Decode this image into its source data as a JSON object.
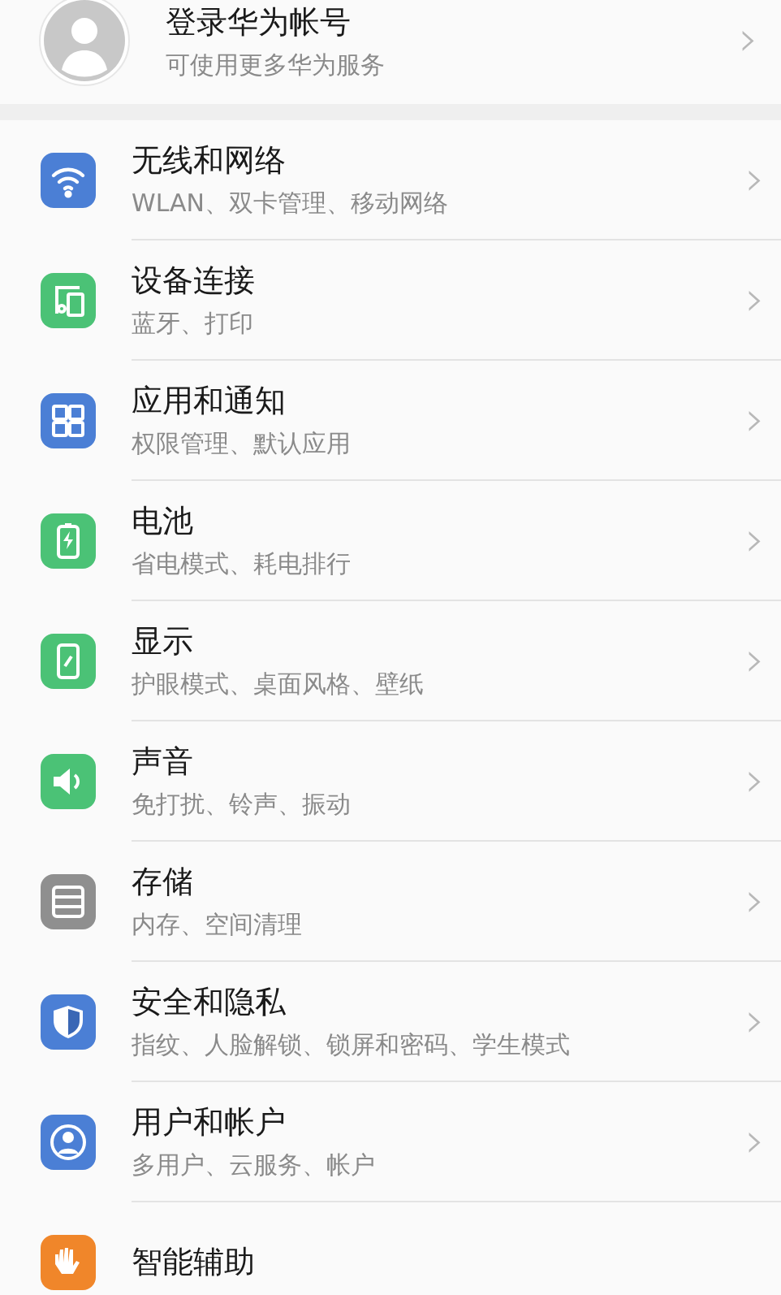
{
  "account": {
    "title": "登录华为帐号",
    "subtitle": "可使用更多华为服务",
    "chevron": "›"
  },
  "items": [
    {
      "title": "无线和网络",
      "subtitle": "WLAN、双卡管理、移动网络",
      "color": "#4b7fd5"
    },
    {
      "title": "设备连接",
      "subtitle": "蓝牙、打印",
      "color": "#4bc276"
    },
    {
      "title": "应用和通知",
      "subtitle": "权限管理、默认应用",
      "color": "#4b7fd5"
    },
    {
      "title": "电池",
      "subtitle": "省电模式、耗电排行",
      "color": "#4bc276"
    },
    {
      "title": "显示",
      "subtitle": "护眼模式、桌面风格、壁纸",
      "color": "#4bc276"
    },
    {
      "title": "声音",
      "subtitle": "免打扰、铃声、振动",
      "color": "#4bc276"
    },
    {
      "title": "存储",
      "subtitle": "内存、空间清理",
      "color": "#8f8f8f"
    },
    {
      "title": "安全和隐私",
      "subtitle": "指纹、人脸解锁、锁屏和密码、学生模式",
      "color": "#4b7fd5"
    },
    {
      "title": "用户和帐户",
      "subtitle": "多用户、云服务、帐户",
      "color": "#4b7fd5"
    },
    {
      "title": "智能辅助",
      "color": "#f0862a"
    }
  ]
}
